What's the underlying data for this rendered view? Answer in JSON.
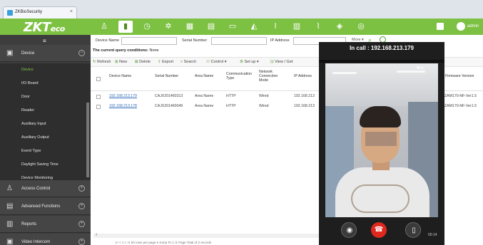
{
  "browser": {
    "tab_title": "ZKBioSecurity",
    "tab_close": "×"
  },
  "header": {
    "logo_main": "ZKT",
    "logo_sub": "eco",
    "icons": [
      "person-icon",
      "door-icon",
      "clock-icon",
      "gear-icon",
      "building-icon",
      "grid-icon",
      "car-icon",
      "chart-icon",
      "torch-icon",
      "elevator-icon",
      "tools-icon",
      "shield-icon",
      "target-icon"
    ],
    "user_name": "admin"
  },
  "sidebar": {
    "menu_icon": "≡",
    "sections": [
      {
        "label": "Device",
        "toggle": "−"
      },
      {
        "label": "Access Control",
        "toggle": "+"
      },
      {
        "label": "Advanced Functions",
        "toggle": "+"
      },
      {
        "label": "Reports",
        "toggle": "+"
      },
      {
        "label": "Video Intercom",
        "toggle": "+"
      }
    ],
    "items": [
      {
        "label": "Device",
        "selected": true
      },
      {
        "label": "I/O Board"
      },
      {
        "label": "Door"
      },
      {
        "label": "Reader"
      },
      {
        "label": "Auxiliary Input"
      },
      {
        "label": "Auxiliary Output"
      },
      {
        "label": "Event Type"
      },
      {
        "label": "Daylight Saving Time"
      },
      {
        "label": "Device Monitoring"
      }
    ]
  },
  "filters": {
    "device_name_label": "Device Name",
    "serial_number_label": "Serial Number",
    "ip_address_label": "IP Address",
    "more_label": "More ▾",
    "conditions_label": "The current query conditions:",
    "conditions_value": "None"
  },
  "toolbar": {
    "refresh": "Refresh",
    "new": "New",
    "delete": "Delete",
    "export": "Export",
    "search": "Search",
    "control": "Control ▾",
    "setup": "Set up ▾",
    "view": "View / Get"
  },
  "table": {
    "headers": {
      "device_name": "Device Name",
      "serial_number": "Serial Number",
      "area_name": "Area Name",
      "comm_type": "Communication Type",
      "net_mode": "Network Connection Mode",
      "ip": "IP Address",
      "firmware": "Firmware Version"
    },
    "rows": [
      {
        "device_name": "192.168.213.179",
        "serial": "CAJX201460313",
        "area": "Area Name",
        "comm": "HTTP",
        "net": "Wired",
        "ip": "192.168.213",
        "firmware": "ZAM170-NF-Ver1.5"
      },
      {
        "device_name": "192.168.213.178",
        "serial": "CAJX201460049",
        "area": "Area Name",
        "comm": "HTTP",
        "net": "Wired",
        "ip": "192.168.213",
        "firmware": "ZAM170-NF-Ver1.5"
      }
    ]
  },
  "pager": {
    "text": "|<  <  1  >  >|    50 rows per page ▾    Jump To  1  /1 Page    Total of 2 records"
  },
  "call": {
    "title": "In call : 192.168.213.179",
    "duration": "00:14",
    "buttons": [
      "camera-icon",
      "hang-up-icon",
      "door-open-icon"
    ]
  }
}
